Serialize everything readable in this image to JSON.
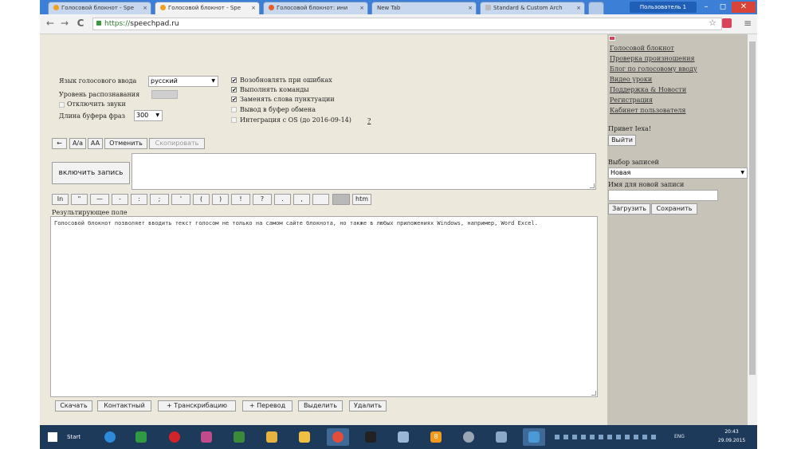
{
  "browser": {
    "tabs": [
      {
        "title": "Голосовой блокнот - Spe",
        "active": false
      },
      {
        "title": "Голосовой блокнот - Spe",
        "active": true
      },
      {
        "title": "Голосовой блокнот: ини",
        "active": false
      },
      {
        "title": "New Tab",
        "active": false
      },
      {
        "title": "Standard & Custom Arch",
        "active": false
      }
    ],
    "tab_close": "×",
    "profile": "Пользователь 1",
    "win_min": "–",
    "win_max": "◻",
    "win_close": "✕",
    "back": "←",
    "forward": "→",
    "reload": "C",
    "url_scheme": "https://",
    "url_host": "speechpad.ru",
    "star": "☆",
    "menu": "≡"
  },
  "settings": {
    "lang_label": "Язык голосового ввода",
    "lang_value": "русский",
    "level_label": "Уровень распознавания",
    "mute_label": "Отключить звуки",
    "buffer_label": "Длина буфера фраз",
    "buffer_value": "300",
    "checkmark": "✔",
    "checkboxes": [
      {
        "label": "Возобновлять при ошибках",
        "checked": true
      },
      {
        "label": "Выполнять команды",
        "checked": true
      },
      {
        "label": "Заменять слова пунктуации",
        "checked": true
      },
      {
        "label": "Вывод в буфер обмена",
        "checked": false
      },
      {
        "label": "Интеграция с OS (до 2016-09-14)",
        "checked": false
      }
    ],
    "help": "?"
  },
  "edit_buttons": {
    "back": "←",
    "case1": "A/a",
    "case2": "AA",
    "cancel": "Отменить",
    "copy": "Скопировать"
  },
  "record_button": "включить запись",
  "punct_buttons": [
    "In",
    "\"",
    "—",
    "-",
    ":",
    ";",
    "'",
    "(",
    ")",
    "!",
    "?",
    ".",
    ",",
    ""
  ],
  "htm_label": "htm",
  "result_label": "Результирующее поле",
  "result_text": "Голосовой блокнот позволяет вводить текст голосом не только на самом сайте блокнота, но также в любых приложениях Windows, например, Word Excel.",
  "bottom_buttons": [
    "Скачать",
    "Контактный",
    "+ Транскрибацию",
    "+ Перевод",
    "Выделить",
    "Удалить"
  ],
  "sidebar": {
    "links": [
      "Голосовой блокнот",
      "Проверка произношения",
      "Блог по голосовому вводу",
      "Видео уроки",
      "Поддержка & Новости",
      "Регистрация",
      "Кабинет пользователя"
    ],
    "greeting": "Привет Iexa!",
    "logout": "Выйти",
    "records_label": "Выбор записей",
    "records_value": "Новая",
    "name_label": "Имя для новой записи",
    "load": "Загрузить",
    "save": "Сохранить"
  },
  "taskbar": {
    "start": "Start",
    "badge": "8",
    "tray_lang": "ENG",
    "time": "20:43",
    "date": "29.09.2015"
  }
}
